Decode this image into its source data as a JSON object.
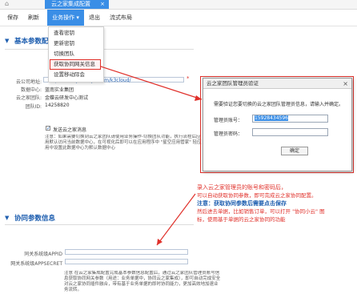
{
  "tabbar": {
    "title": "云之家集成配置"
  },
  "toolbar": {
    "save": "保存",
    "refresh": "刷新",
    "ops": "业务操作",
    "exit": "退出",
    "flow": "流式布局"
  },
  "dropdown": {
    "items": [
      "查看密钥",
      "更新密钥",
      "切换团队",
      "获取协同网关信息",
      "设置移动际会"
    ]
  },
  "section1": {
    "title": "基本参数配置",
    "url_label": "云公司地址:",
    "url_value": "http://www.yunzhijia.com/k3cloud/",
    "db_label": "数据中心:",
    "db_value": "蓝南实业集团",
    "team_label": "云之家团队:",
    "team_value": "金蝶云研发中心测试",
    "teamid_label": "团队ID:",
    "teamid_value": "14258820",
    "checkbox_label": "发送云之家消息",
    "note": "注意：如果需要切换到云之家团队请使用业务操作-切换团队功能，执行流程后应用默认访问当前数据中心，在可视化后即可以在应用程序中 \"星空应用管家\" 轻应用中设置此数据中心为默认数据中心"
  },
  "section2": {
    "title": "协同参数信息",
    "appid_label": "同关系统级APPID",
    "secret_label": "网关系统级APPSECRET",
    "note": "注意 在云之家集成配置完成基本参数信息配置后，通过云之家团队管理员账号信息获取协同网关参数（用途：业务单据中，协同云之家集成），即可自动完成安全对云之家协同插件融合，带有基于业务单据的即时协同能力，更加高效地加速业务流转。"
  },
  "dialog": {
    "title": "云之家团队管理员验证",
    "tip": "需要验证您要切换的云之家团队管理员信息，请输入并确定。",
    "account_label": "管理员账号：",
    "account_value": "15928434596",
    "password_label": "管理员密码：",
    "ok": "确定"
  },
  "annotation": {
    "line1": "录入云之家管理员的账号和密码后，",
    "line2": "可以自动获取协同参数，即可完成云之家协同配置。",
    "line3": "注意：获取协同参数后需要点击保存",
    "line4": "然后进去单据，比如销售订单，可以打开 \"协同小云\" 图",
    "line5": "标，使用基于单据的云之家协同的功能"
  },
  "colors": {
    "accent": "#3a8ee6",
    "highlight": "#e0302a",
    "title": "#1f5fb0"
  }
}
